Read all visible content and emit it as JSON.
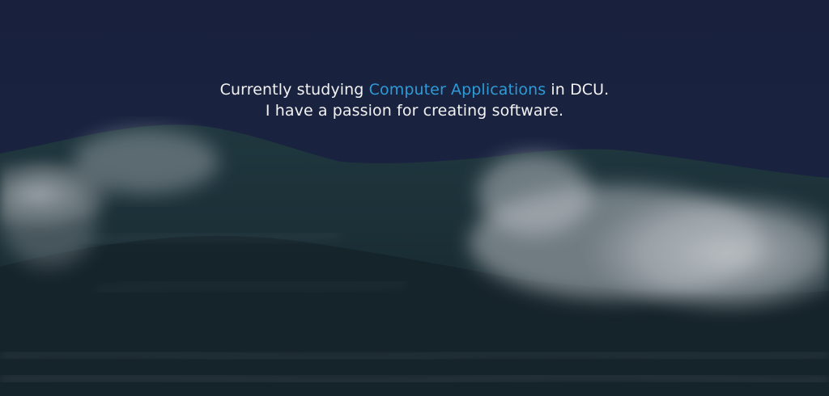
{
  "hero": {
    "background_image": "stormy-ocean-wave",
    "tagline": {
      "line1_prefix": "Currently studying ",
      "line1_highlight": "Computer Applications",
      "line1_suffix": " in DCU.",
      "line2": "I have a passion for creating software."
    }
  },
  "colors": {
    "sky": "#1b2544",
    "text": "#f2f2f2",
    "accent": "#2e9bd6",
    "wave_dark": "#1f3a3a",
    "foam": "#d8dde0"
  }
}
